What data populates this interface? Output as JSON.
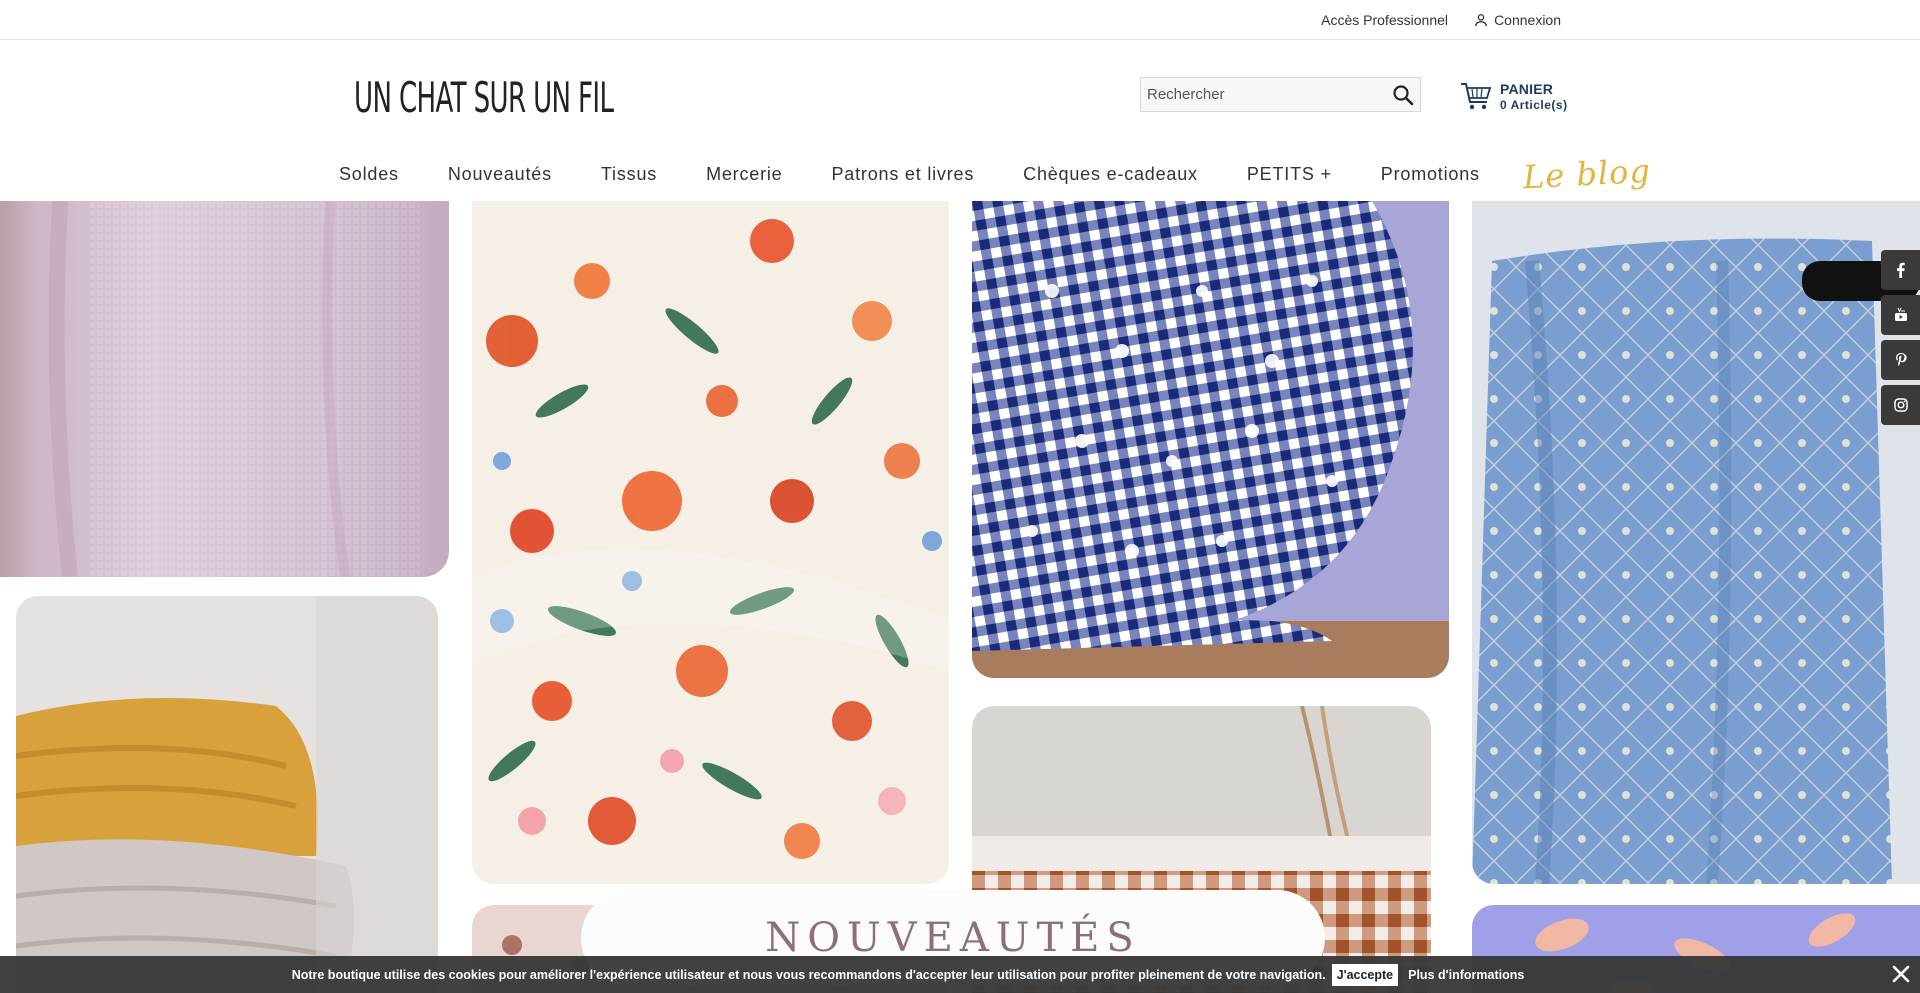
{
  "topbar": {
    "pro_label": "Accès Professionnel",
    "login_label": "Connexion"
  },
  "header": {
    "logo_text": "UN CHAT SUR UN FIL",
    "search_placeholder": "Rechercher",
    "cart_title": "PANIER",
    "cart_count": "0 Article(s)"
  },
  "nav": {
    "items": [
      "Soldes",
      "Nouveautés",
      "Tissus",
      "Mercerie",
      "Patrons et livres",
      "Chèques e-cadeaux",
      "PETITS +",
      "Promotions"
    ],
    "blog_label": "Le blog"
  },
  "banner": {
    "title": "NOUVEAUTÉS"
  },
  "social": {
    "icons": [
      "facebook-icon",
      "youtube-icon",
      "pinterest-icon",
      "instagram-icon"
    ]
  },
  "cookie": {
    "message": "Notre boutique utilise des cookies pour améliorer l'expérience utilisateur et nous vous recommandons d'accepter leur utilisation pour profiter pleinement de votre navigation.",
    "accept_label": "J'accepte",
    "more_label": "Plus d'informations"
  },
  "colors": {
    "blog_accent": "#e3b33c",
    "cart_text": "#1e3a5f",
    "banner_text": "#8f6f76",
    "cookie_bg": "#373737"
  }
}
